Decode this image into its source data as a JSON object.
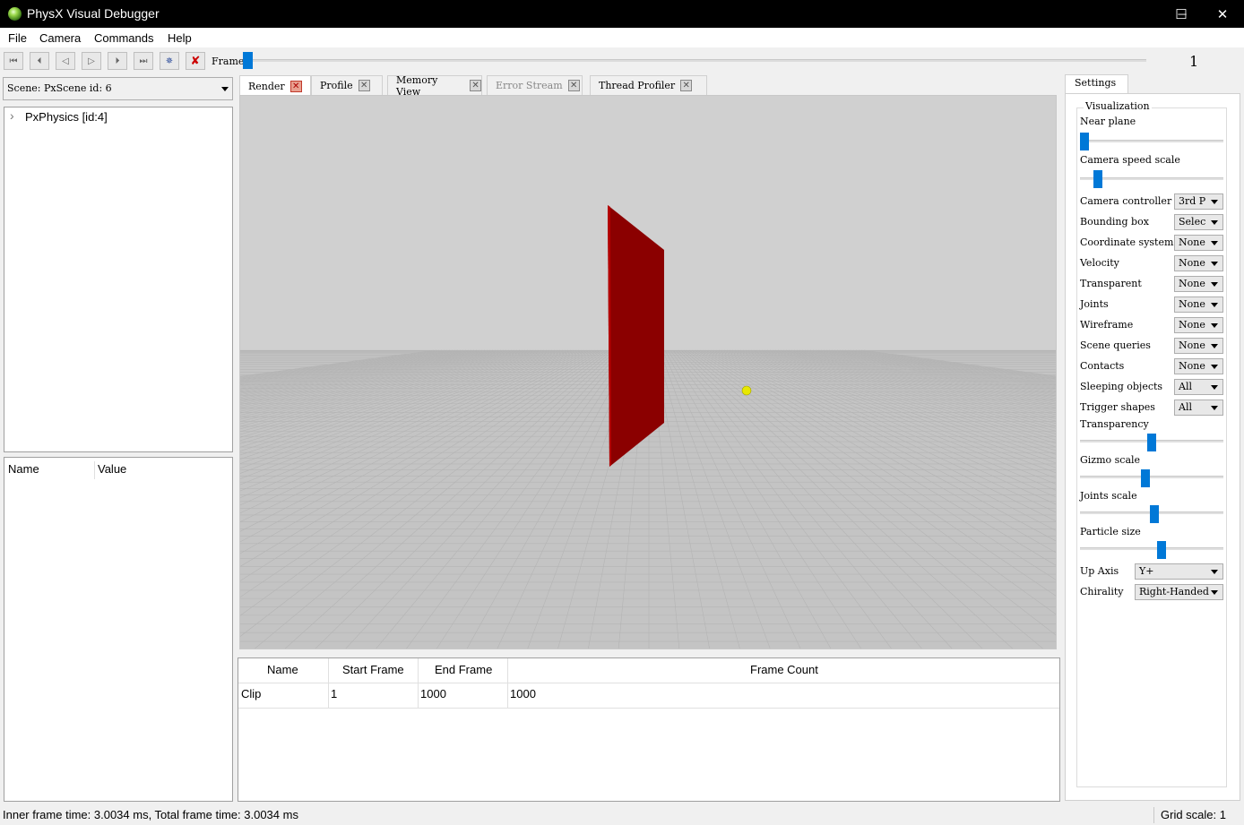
{
  "window": {
    "title": "PhysX Visual Debugger",
    "minimize": "─",
    "maximize": "☐",
    "close": "✕"
  },
  "menu": [
    "File",
    "Camera",
    "Commands",
    "Help"
  ],
  "toolbar": {
    "frame_label": "Frame",
    "frame_value": "1",
    "frame_position": 0.0
  },
  "scene": {
    "selector": "Scene: PxScene id: 6",
    "tree_item": "PxPhysics [id:4]",
    "expander": "›"
  },
  "properties": {
    "col_name": "Name",
    "col_value": "Value"
  },
  "tabs": [
    {
      "label": "Render",
      "active": true
    },
    {
      "label": "Profile"
    },
    {
      "label": "Memory View"
    },
    {
      "label": "Error Stream",
      "disabled": true
    },
    {
      "label": "Thread Profiler"
    }
  ],
  "clips": {
    "headers": [
      "Name",
      "Start Frame",
      "End Frame",
      "Frame Count"
    ],
    "rows": [
      [
        "Clip",
        "1",
        "1000",
        "1000"
      ]
    ]
  },
  "settings": {
    "tab": "Settings",
    "group": "Visualization",
    "near_plane": "Near plane",
    "camera_speed_scale": "Camera speed scale",
    "dropdowns": [
      {
        "label": "Camera controller",
        "value": "3rd P"
      },
      {
        "label": "Bounding box",
        "value": "Selec"
      },
      {
        "label": "Coordinate system",
        "value": "None"
      },
      {
        "label": "Velocity",
        "value": "None"
      },
      {
        "label": "Transparent",
        "value": "None"
      },
      {
        "label": "Joints",
        "value": "None"
      },
      {
        "label": "Wireframe",
        "value": "None"
      },
      {
        "label": "Scene queries",
        "value": "None"
      },
      {
        "label": "Contacts",
        "value": "None"
      },
      {
        "label": "Sleeping objects",
        "value": "All"
      },
      {
        "label": "Trigger shapes",
        "value": "All"
      }
    ],
    "transparency": "Transparency",
    "gizmo_scale": "Gizmo scale",
    "joints_scale": "Joints scale",
    "particle_size": "Particle size",
    "up_axis": {
      "label": "Up Axis",
      "value": "Y+"
    },
    "chirality": {
      "label": "Chirality",
      "value": "Right-Handed"
    },
    "slider_levels": {
      "near_plane": 0.0,
      "camera_speed": 0.1,
      "transparency": 0.5,
      "gizmo": 0.45,
      "joints": 0.52,
      "particle": 0.57
    }
  },
  "status": {
    "left": "Inner frame time: 3.0034 ms, Total frame time: 3.0034 ms",
    "right": "Grid scale: 1"
  },
  "colors": {
    "object_red": "#8b0000",
    "sphere": "#e8e800",
    "sky": "#d0d0d0",
    "ground": "#c4c4c4",
    "accent": "#0078d7"
  }
}
